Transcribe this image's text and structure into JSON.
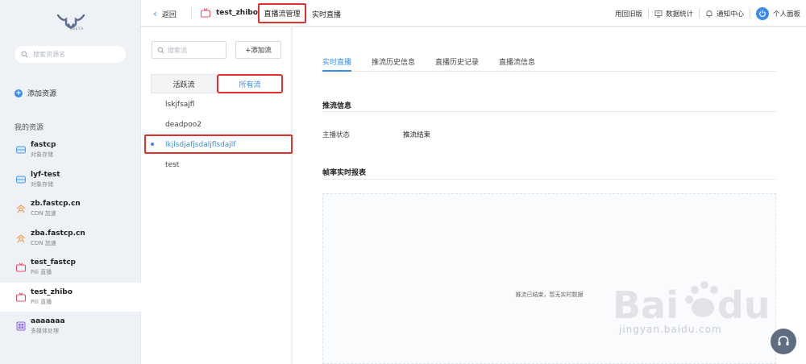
{
  "sidebar": {
    "logo_text": "BETA",
    "search_placeholder": "搜索资源名",
    "add_resource": "添加资源",
    "my_resources": "我的资源",
    "resources": [
      {
        "name": "fastcp",
        "type": "对象存储",
        "icon": "storage-icon"
      },
      {
        "name": "lyf-test",
        "type": "对象存储",
        "icon": "storage-icon"
      },
      {
        "name": "zb.fastcp.cn",
        "type": "CDN 加速",
        "icon": "cdn-icon"
      },
      {
        "name": "zba.fastcp.cn",
        "type": "CDN 加速",
        "icon": "cdn-icon"
      },
      {
        "name": "test_fastcp",
        "type": "Pili 直播",
        "icon": "live-icon"
      },
      {
        "name": "test_zhibo",
        "type": "Pili 直播",
        "icon": "live-icon",
        "active": true
      },
      {
        "name": "aaaaaaa",
        "type": "多媒体处理",
        "icon": "media-icon"
      }
    ]
  },
  "topbar": {
    "back": "返回",
    "resource_name": "test_zhibo",
    "tab_manage": "直播流管理",
    "tab_live": "实时直播",
    "old_version": "用回旧版",
    "stats": "数据统计",
    "notifications": "通知中心",
    "profile": "个人面板"
  },
  "streams": {
    "search_placeholder": "搜索流",
    "add_button": "+添加流",
    "tab_active": "活跃流",
    "tab_all": "所有流",
    "items": [
      {
        "name": "lskjfsajfl"
      },
      {
        "name": "deadpoo2"
      },
      {
        "name": "lkjlsdjafjsdaljflsdajlf",
        "selected": true
      },
      {
        "name": "test"
      }
    ]
  },
  "main": {
    "tabs": [
      "实时直播",
      "推流历史信息",
      "直播历史记录",
      "直播流信息"
    ],
    "push_info_title": "推流信息",
    "status_key": "主播状态",
    "status_value": "推流结束",
    "chart_title": "帧率实时报表",
    "chart_empty": "推流已结束，暂无实时数据"
  },
  "watermark": "jingyan.baidu.com",
  "colors": {
    "accent": "#3b8ce8",
    "highlight": "#e0302f"
  }
}
